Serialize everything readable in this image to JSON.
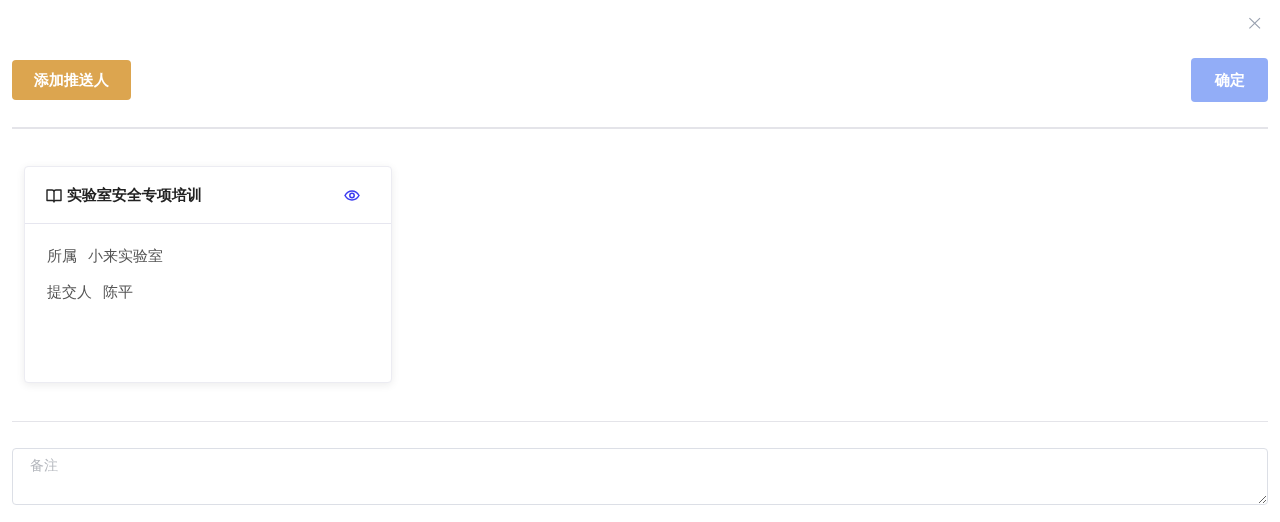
{
  "close_button": {
    "label": "×"
  },
  "toolbar": {
    "add_button": {
      "label": "添加推送人"
    },
    "confirm_button": {
      "label": "确定",
      "disabled": true
    }
  },
  "cards": [
    {
      "title": "实验室安全专项培训",
      "fields": [
        {
          "label": "所属",
          "value": "小来实验室"
        },
        {
          "label": "提交人",
          "value": "陈平"
        }
      ]
    }
  ],
  "remark": {
    "placeholder": "备注"
  }
}
